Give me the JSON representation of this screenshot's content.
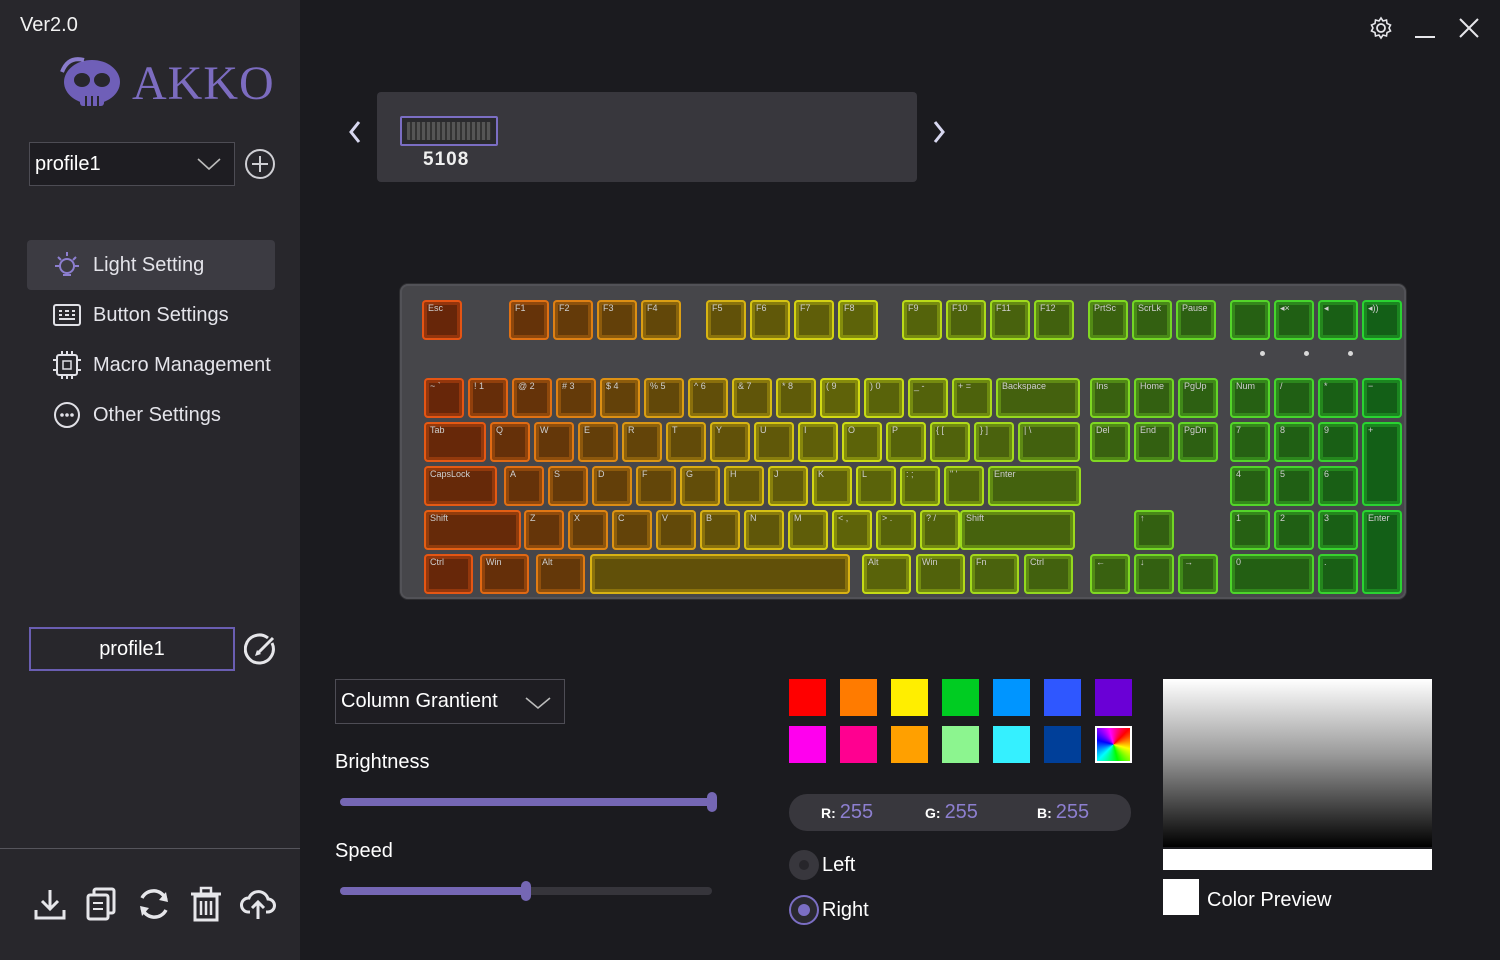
{
  "app": {
    "version": "Ver2.0",
    "brand": "AKKO"
  },
  "sidebar": {
    "profile_select_value": "profile1",
    "menu": [
      {
        "label": "Light Setting",
        "icon": "bulb-icon",
        "active": true
      },
      {
        "label": "Button Settings",
        "icon": "keyboard-icon",
        "active": false
      },
      {
        "label": "Macro Management",
        "icon": "chip-icon",
        "active": false
      },
      {
        "label": "Other Settings",
        "icon": "more-icon",
        "active": false
      }
    ],
    "profile_name": "profile1",
    "tools": [
      "download-icon",
      "copy-icon",
      "refresh-icon",
      "trash-icon",
      "upload-cloud-icon"
    ]
  },
  "device": {
    "name": "5108"
  },
  "keyboard": {
    "rows": [
      [
        "Esc",
        "F1",
        "F2",
        "F3",
        "F4",
        "F5",
        "F6",
        "F7",
        "F8",
        "F9",
        "F10",
        "F11",
        "F12",
        "PrtSc",
        "ScrLk",
        "Pause",
        "",
        "◂×",
        "◂",
        "◂))"
      ],
      [
        "~ `",
        "! 1",
        "@ 2",
        "# 3",
        "$ 4",
        "% 5",
        "^ 6",
        "& 7",
        "* 8",
        "( 9",
        ") 0",
        "_ -",
        "+ =",
        "Backspace",
        "Ins",
        "Home",
        "PgUp",
        "Num",
        "/",
        "*",
        "−"
      ],
      [
        "Tab",
        "Q",
        "W",
        "E",
        "R",
        "T",
        "Y",
        "U",
        "I",
        "O",
        "P",
        "{ [",
        "} ]",
        "| \\",
        "Del",
        "End",
        "PgDn",
        "7",
        "8",
        "9",
        "+"
      ],
      [
        "CapsLock",
        "A",
        "S",
        "D",
        "F",
        "G",
        "H",
        "J",
        "K",
        "L",
        ": ;",
        "\" '",
        "Enter",
        "4",
        "5",
        "6"
      ],
      [
        "Shift",
        "Z",
        "X",
        "C",
        "V",
        "B",
        "N",
        "M",
        "< ,",
        "> .",
        "? /",
        "Shift",
        "↑",
        "1",
        "2",
        "3",
        "Enter"
      ],
      [
        "Ctrl",
        "Win",
        "Alt",
        "",
        "Alt",
        "Win",
        "Fn",
        "Ctrl",
        "←",
        "↓",
        "→",
        "0",
        "."
      ]
    ]
  },
  "lighting": {
    "mode": "Column Grantient",
    "brightness_label": "Brightness",
    "brightness_value": 1.0,
    "speed_label": "Speed",
    "speed_value": 0.5,
    "swatches": [
      "#ff0000",
      "#ff7b00",
      "#ffee00",
      "#00cc22",
      "#0095ff",
      "#2f57ff",
      "#6a00d6",
      "#ff00ee",
      "#ff0090",
      "#ffa000",
      "#8cf58f",
      "#35f0ff",
      "#003f99",
      "rainbow"
    ],
    "rgb": {
      "r_label": "R:",
      "r": "255",
      "g_label": "G:",
      "g": "255",
      "b_label": "B:",
      "b": "255"
    },
    "direction_left": "Left",
    "direction_right": "Right",
    "direction_selected": "Right",
    "color_preview_label": "Color Preview",
    "accent": "#7567b4"
  }
}
